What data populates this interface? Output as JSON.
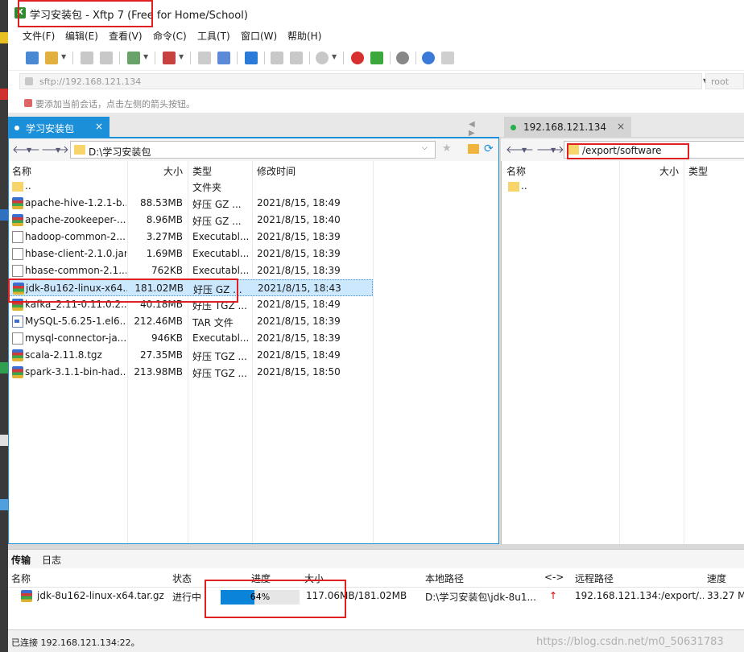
{
  "window": {
    "title": "学习安装包 - Xftp 7 (Free for Home/School)"
  },
  "menu": [
    "文件(F)",
    "编辑(E)",
    "查看(V)",
    "命令(C)",
    "工具(T)",
    "窗口(W)",
    "帮助(H)"
  ],
  "address": {
    "placeholder": "sftp://192.168.121.134",
    "user_placeholder": "root"
  },
  "hint": "要添加当前会话，点击左侧的箭头按钮。",
  "left_pane": {
    "tab_label": "学习安装包",
    "close": "×",
    "nav_arrows": "◀ ▶",
    "path": "D:\\学习安装包",
    "columns": [
      "名称",
      "大小",
      "类型",
      "修改时间"
    ],
    "rows": [
      {
        "icon": "folder",
        "name": "..",
        "size": "",
        "type": "文件夹",
        "modified": ""
      },
      {
        "icon": "archive",
        "name": "apache-hive-1.2.1-b...",
        "size": "88.53MB",
        "type": "好压 GZ ...",
        "modified": "2021/8/15, 18:49"
      },
      {
        "icon": "archive",
        "name": "apache-zookeeper-...",
        "size": "8.96MB",
        "type": "好压 GZ ...",
        "modified": "2021/8/15, 18:40"
      },
      {
        "icon": "file",
        "name": "hadoop-common-2...",
        "size": "3.27MB",
        "type": "Executabl...",
        "modified": "2021/8/15, 18:39"
      },
      {
        "icon": "file",
        "name": "hbase-client-2.1.0.jar",
        "size": "1.69MB",
        "type": "Executabl...",
        "modified": "2021/8/15, 18:39"
      },
      {
        "icon": "file",
        "name": "hbase-common-2.1...",
        "size": "762KB",
        "type": "Executabl...",
        "modified": "2021/8/15, 18:39"
      },
      {
        "icon": "archive",
        "name": "jdk-8u162-linux-x64...",
        "size": "181.02MB",
        "type": "好压 GZ ...",
        "modified": "2021/8/15, 18:43",
        "selected": true
      },
      {
        "icon": "archive",
        "name": "kafka_2.11-0.11.0.2...",
        "size": "40.18MB",
        "type": "好压 TGZ ...",
        "modified": "2021/8/15, 18:49"
      },
      {
        "icon": "tar",
        "name": "MySQL-5.6.25-1.el6....",
        "size": "212.46MB",
        "type": "TAR 文件",
        "modified": "2021/8/15, 18:39"
      },
      {
        "icon": "file",
        "name": "mysql-connector-ja...",
        "size": "946KB",
        "type": "Executabl...",
        "modified": "2021/8/15, 18:39"
      },
      {
        "icon": "archive",
        "name": "scala-2.11.8.tgz",
        "size": "27.35MB",
        "type": "好压 TGZ ...",
        "modified": "2021/8/15, 18:49"
      },
      {
        "icon": "archive",
        "name": "spark-3.1.1-bin-had...",
        "size": "213.98MB",
        "type": "好压 TGZ ...",
        "modified": "2021/8/15, 18:50"
      }
    ]
  },
  "right_pane": {
    "tab_label": "192.168.121.134",
    "close": "×",
    "path": "/export/software",
    "columns": [
      "名称",
      "大小",
      "类型"
    ],
    "rows": [
      {
        "icon": "folder",
        "name": ".."
      }
    ]
  },
  "transfer": {
    "tabs": [
      "传输",
      "日志"
    ],
    "columns": [
      "名称",
      "状态",
      "进度",
      "大小",
      "本地路径",
      "<->",
      "远程路径",
      "速度"
    ],
    "row": {
      "name": "jdk-8u162-linux-x64.tar.gz",
      "status": "进行中",
      "progress": 64,
      "progress_label": "64%",
      "size": "117.06MB/181.02MB",
      "local_path": "D:\\学习安装包\\jdk-8u1...",
      "direction": "↑",
      "remote_path": "192.168.121.134:/export/...",
      "speed": "33.27 M"
    }
  },
  "status": {
    "text": "已连接 192.168.121.134:22。",
    "watermark": "https://blog.csdn.net/m0_50631783"
  },
  "colors": {
    "accent": "#1b8fd8",
    "progress": "#0a84d8",
    "highlight_box": "#e02020",
    "connected": "#22b14c"
  }
}
